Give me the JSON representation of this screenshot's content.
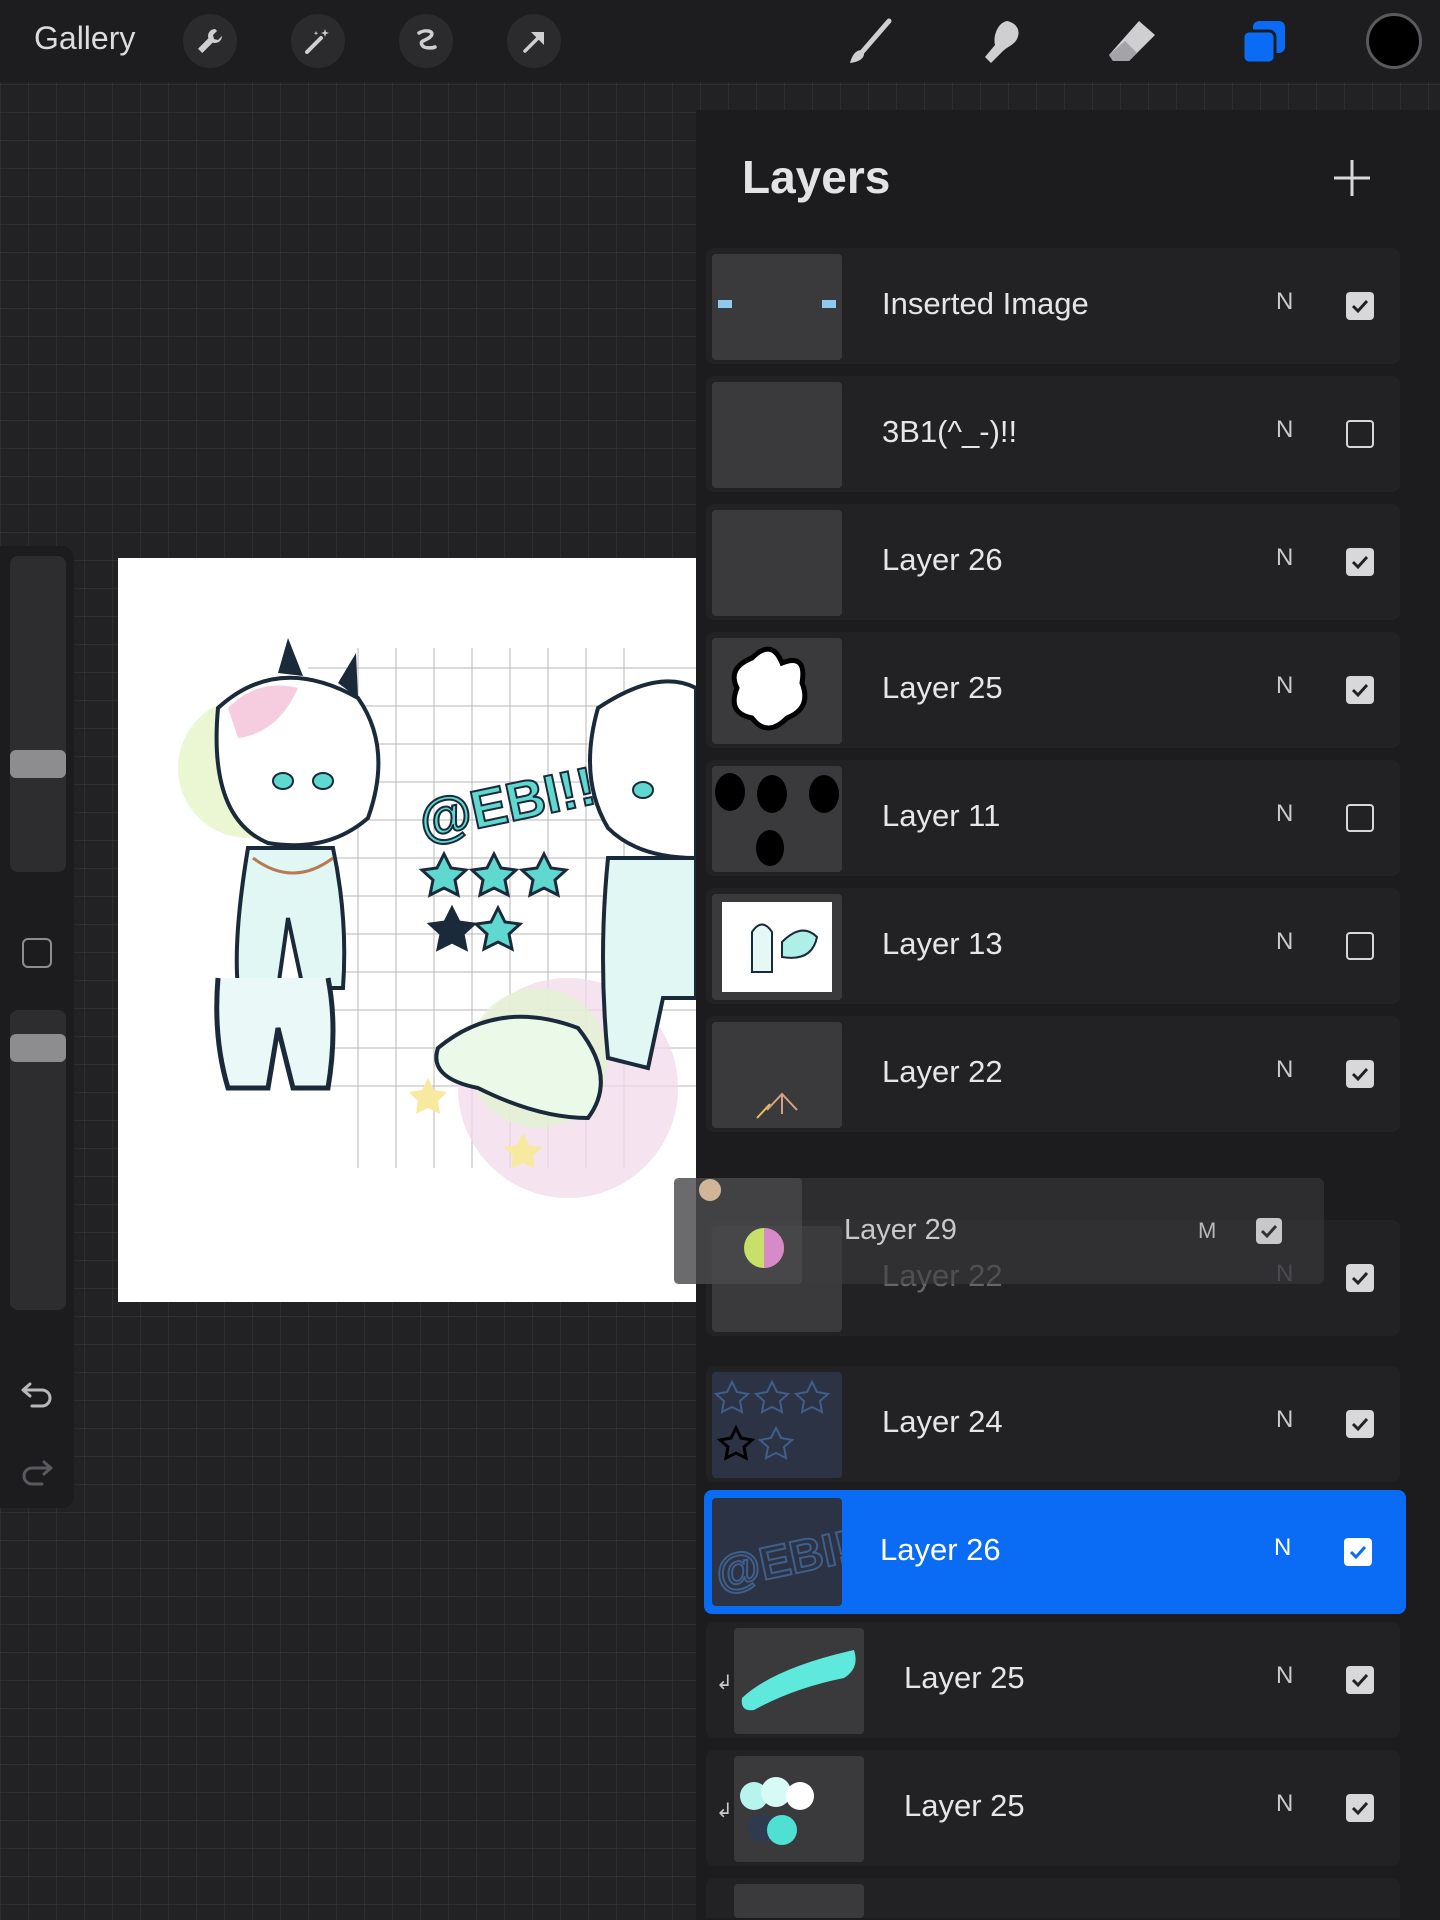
{
  "toolbar": {
    "gallery_label": "Gallery",
    "left_tools": [
      "wrench-icon",
      "magic-wand-icon",
      "selection-icon",
      "transform-arrow-icon"
    ],
    "right_tools": [
      "brush-icon",
      "smudge-icon",
      "eraser-icon",
      "layers-icon"
    ],
    "active_tool": "layers-icon",
    "current_color": "#000000"
  },
  "layers_panel": {
    "title": "Layers",
    "add_label": "+",
    "layers": [
      {
        "name": "Inserted Image",
        "mode": "N",
        "visible": true
      },
      {
        "name": "3B1(^_-)!!",
        "mode": "N",
        "visible": false
      },
      {
        "name": "Layer 26",
        "mode": "N",
        "visible": true
      },
      {
        "name": "Layer 25",
        "mode": "N",
        "visible": true
      },
      {
        "name": "Layer 11",
        "mode": "N",
        "visible": false
      },
      {
        "name": "Layer 13",
        "mode": "N",
        "visible": false
      },
      {
        "name": "Layer 22",
        "mode": "N",
        "visible": true
      },
      {
        "name": "Layer 22",
        "mode": "N",
        "visible": true
      },
      {
        "name": "Layer 24",
        "mode": "N",
        "visible": true
      },
      {
        "name": "Layer 26",
        "mode": "N",
        "visible": true,
        "selected": true
      },
      {
        "name": "Layer 25",
        "mode": "N",
        "visible": true,
        "clipped": true
      },
      {
        "name": "Layer 25",
        "mode": "N",
        "visible": true,
        "clipped": true
      }
    ],
    "dragging_layer": {
      "name": "Layer 29",
      "mode": "M",
      "visible": true
    }
  },
  "canvas_art": {
    "text": "@EBI!!"
  },
  "colors": {
    "accent": "#0a6cf5",
    "panel": "#1c1c1e",
    "teal": "#5fd8d0"
  }
}
